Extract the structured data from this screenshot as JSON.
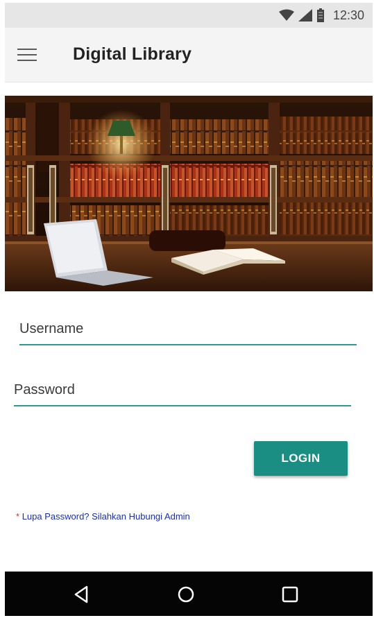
{
  "status_bar": {
    "time": "12:30",
    "icons": [
      "wifi-icon",
      "signal-icon",
      "battery-icon"
    ]
  },
  "app_bar": {
    "menu_icon": "hamburger-menu-icon",
    "title": "Digital Library"
  },
  "hero": {
    "image": "library-bookshelves-laptop-open-book-photo"
  },
  "form": {
    "username": {
      "placeholder": "Username",
      "value": ""
    },
    "password": {
      "placeholder": "Password",
      "value": ""
    },
    "login_label": "LOGIN",
    "forgot_asterisk": "*",
    "forgot_text": "Lupa Password? Silahkan Hubungi Admin"
  },
  "nav_bar": {
    "back_icon": "back-triangle-icon",
    "home_icon": "home-circle-icon",
    "recents_icon": "recents-square-icon"
  },
  "colors": {
    "accent": "#1b8e83",
    "underline": "#2b9b8f",
    "link": "#1a2fa8",
    "asterisk": "#d93232"
  }
}
